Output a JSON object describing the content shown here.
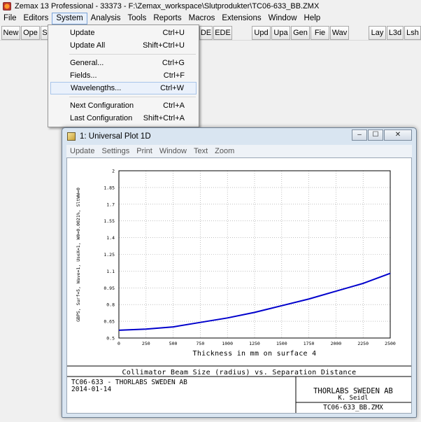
{
  "app": {
    "title": "Zemax 13 Professional - 33373 - F:\\Zemax_workspace\\Slutprodukter\\TC06-633_BB.ZMX"
  },
  "menubar": [
    "File",
    "Editors",
    "System",
    "Analysis",
    "Tools",
    "Reports",
    "Macros",
    "Extensions",
    "Window",
    "Help"
  ],
  "toolbar": {
    "left": [
      "New",
      "Ope",
      "S"
    ],
    "mid": [
      "DE",
      "EDE"
    ],
    "right": [
      "Upd",
      "Upa",
      "Gen",
      "Fie",
      "Wav"
    ],
    "far": [
      "Lay",
      "L3d",
      "Lsh"
    ]
  },
  "system_menu": {
    "items": [
      {
        "label": "Update",
        "shortcut": "Ctrl+U"
      },
      {
        "label": "Update All",
        "shortcut": "Shift+Ctrl+U"
      },
      {
        "sep": true
      },
      {
        "label": "General...",
        "shortcut": "Ctrl+G"
      },
      {
        "label": "Fields...",
        "shortcut": "Ctrl+F"
      },
      {
        "label": "Wavelengths...",
        "shortcut": "Ctrl+W",
        "highlighted": true
      },
      {
        "sep": true
      },
      {
        "label": "Next Configuration",
        "shortcut": "Ctrl+A"
      },
      {
        "label": "Last Configuration",
        "shortcut": "Shift+Ctrl+A"
      }
    ]
  },
  "plot_window": {
    "title": "1: Universal Plot 1D",
    "menu": [
      "Update",
      "Settings",
      "Print",
      "Window",
      "Text",
      "Zoom"
    ],
    "buttons": {
      "minimize": "‒",
      "maximize": "☐",
      "close": "✕"
    }
  },
  "chart_data": {
    "type": "line",
    "xlabel": "Thickness in mm on surface 4",
    "ylabel": "GBPS, Surf=5, Wave=1, UseX=1, W0=0.0021%, SltWW=0",
    "xlim": [
      0,
      2500
    ],
    "ylim": [
      0.5,
      2
    ],
    "x_ticks": [
      "0",
      "250",
      "500",
      "750",
      "1000",
      "1250",
      "1500",
      "1750",
      "2000",
      "2250",
      "2500"
    ],
    "y_ticks": [
      "0.5",
      "0.65",
      "0.8",
      "0.95",
      "1.1",
      "1.25",
      "1.4",
      "1.55",
      "1.7",
      "1.85",
      "2"
    ],
    "grid": true,
    "series": [
      {
        "color": "#0000cc",
        "x": [
          0,
          250,
          500,
          750,
          1000,
          1250,
          1500,
          1750,
          2000,
          2250,
          2500
        ],
        "y": [
          0.57,
          0.58,
          0.6,
          0.64,
          0.68,
          0.73,
          0.79,
          0.85,
          0.92,
          0.99,
          1.08
        ]
      }
    ],
    "caption": {
      "title": "Collimator Beam Size (radius) vs. Separation Distance",
      "left_line1": "TC06-633 - THORLABS SWEDEN AB",
      "left_line2": "2014-01-14",
      "company": "THORLABS SWEDEN AB",
      "author": "K. Seidl",
      "file": "TC06-633_BB.ZMX"
    }
  }
}
